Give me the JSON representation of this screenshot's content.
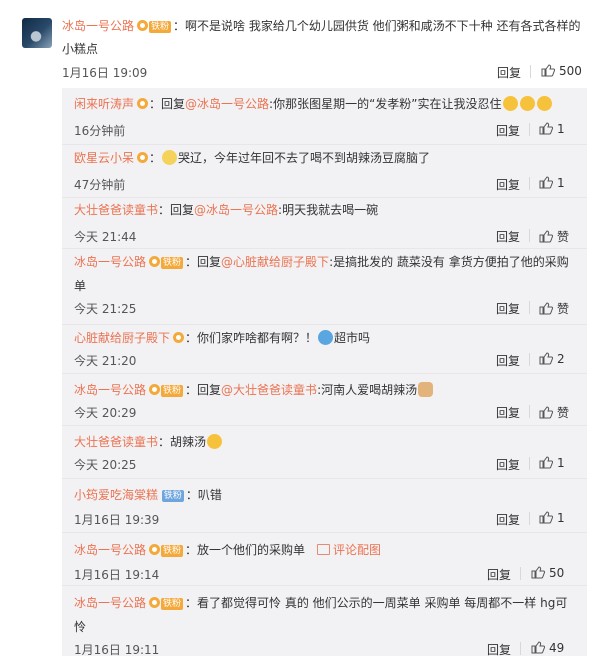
{
  "root": {
    "user": "冰岛一号公路",
    "badge": "铁粉",
    "text": "：啊不是说啥 我家给几个幼儿园供货 他们粥和咸汤不下十种 还有各式各样的小糕点",
    "time": "1月16日 19:09",
    "reply_label": "回复",
    "like_count": "500"
  },
  "replies": [
    {
      "user": "闲来听涛声",
      "pre": "：回复",
      "mention": "@冰岛一号公路",
      "text": ":你那张图星期一的“发孝粉”实在让我没忍住",
      "time": "16分钟前",
      "reply_label": "回复",
      "like": "1"
    },
    {
      "user": "欧星云小呆",
      "pre": "：",
      "text": "哭辽，今年过年回不去了喝不到胡辣汤豆腐脑了",
      "time": "47分钟前",
      "reply_label": "回复",
      "like": "1"
    },
    {
      "user": "大壮爸爸读童书",
      "pre": "：回复",
      "mention": "@冰岛一号公路",
      "text": ":明天我就去喝一碗",
      "time": "今天 21:44",
      "reply_label": "回复",
      "like": "赞"
    },
    {
      "user": "冰岛一号公路",
      "badge": "铁粉",
      "pre": "：回复",
      "mention": "@心脏献给厨子殿下",
      "text": ":是搞批发的  蔬菜没有 拿货方便拍了他的采购单",
      "time": "今天 21:25",
      "reply_label": "回复",
      "like": "赞"
    },
    {
      "user": "心脏献给厨子殿下",
      "pre": "：你们家咋啥都有啊？！",
      "text": "超市吗",
      "time": "今天 21:20",
      "reply_label": "回复",
      "like": "2"
    },
    {
      "user": "冰岛一号公路",
      "badge": "铁粉",
      "pre": "：回复",
      "mention": "@大壮爸爸读童书",
      "text": ":河南人爱喝胡辣汤",
      "time": "今天 20:29",
      "reply_label": "回复",
      "like": "赞"
    },
    {
      "user": "大壮爸爸读童书",
      "pre": "：胡辣汤",
      "time": "今天 20:25",
      "reply_label": "回复",
      "like": "1"
    },
    {
      "user": "小筠爱吃海棠糕",
      "badge": "铁粉",
      "pre": "：叭错",
      "time": "1月16日 19:39",
      "reply_label": "回复",
      "like": "1"
    },
    {
      "user": "冰岛一号公路",
      "badge": "铁粉",
      "pre": "：放一个他们的采购单",
      "img_label": "评论配图",
      "time": "1月16日 19:14",
      "reply_label": "回复",
      "like": "50"
    },
    {
      "user": "冰岛一号公路",
      "badge": "铁粉",
      "pre": "：看了都觉得可怜 真的 他们公示的一周菜单 采购单 每周都不一样 hg可怜",
      "time": "1月16日 19:11",
      "reply_label": "回复",
      "like": "49"
    }
  ]
}
